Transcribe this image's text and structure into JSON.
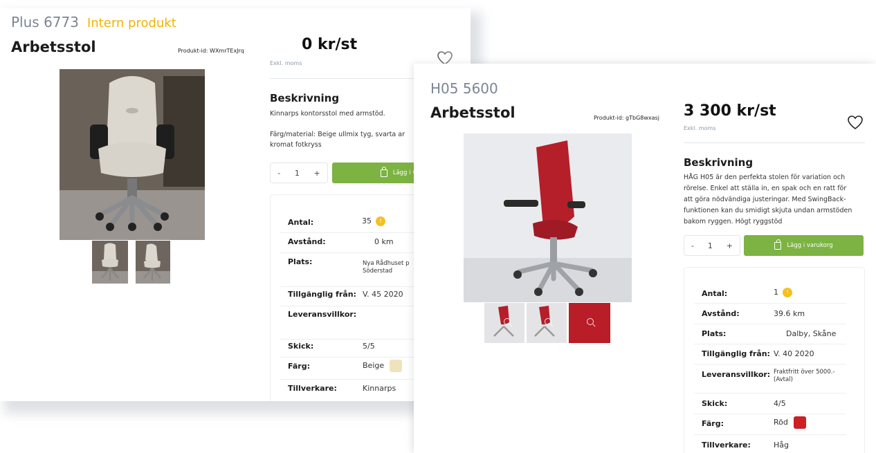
{
  "left_card": {
    "code": "Plus 6773",
    "tag": "Intern produkt",
    "title": "Arbetsstol",
    "product_id": "Produkt-id: WXmrTExJrq",
    "price": "0 kr/st",
    "exkl": "Exkl. moms",
    "description_heading": "Beskrivning",
    "description_line1": "Kinnarps kontorsstol med armstöd.",
    "description_line2": "Färg/material: Beige ullmix tyg, svarta ar",
    "description_line3": "kromat fotkryss",
    "qty_minus": "-",
    "qty_value": "1",
    "qty_plus": "+",
    "cart_label": "Lägg i varuk",
    "specs": {
      "antal_label": "Antal:",
      "antal_value": "35",
      "avstand_label": "Avstånd:",
      "avstand_value": "0 km",
      "plats_label": "Plats:",
      "plats_value_1": "Nya Rådhuset p",
      "plats_value_2": "Söderstad",
      "tillganglig_label": "Tillgänglig från:",
      "tillganglig_value": "V. 45 2020",
      "leverans_label": "Leveransvillkor:",
      "skick_label": "Skick:",
      "skick_value": "5/5",
      "farg_label": "Färg:",
      "farg_value": "Beige",
      "farg_color": "#efe3bd",
      "tillverkare_label": "Tillverkare:",
      "tillverkare_value": "Kinnarps"
    }
  },
  "right_card": {
    "code": "H05 5600",
    "title": "Arbetsstol",
    "product_id": "Produkt-id: gTbG8wxasj",
    "price": "3 300 kr/st",
    "exkl": "Exkl. moms",
    "description_heading": "Beskrivning",
    "description_lines": [
      "HÅG H05 är den perfekta stolen för variation och",
      "rörelse. Enkel att ställa in, en spak och en ratt för",
      "att göra nödvändiga justeringar. Med SwingBack-",
      "funktionen kan du smidigt skjuta undan armstöden",
      "bakom ryggen. Högt ryggstöd"
    ],
    "qty_minus": "-",
    "qty_value": "1",
    "qty_plus": "+",
    "cart_label": "Lägg i varukorg",
    "specs": {
      "antal_label": "Antal:",
      "antal_value": "1",
      "avstand_label": "Avstånd:",
      "avstand_value": "39.6 km",
      "plats_label": "Plats:",
      "plats_value": "Dalby, Skåne",
      "tillganglig_label": "Tillgänglig från:",
      "tillganglig_value": "V. 40 2020",
      "leverans_label": "Leveransvillkor:",
      "leverans_value_1": "Fraktfritt över 5000.-",
      "leverans_value_2": "(Avtal)",
      "skick_label": "Skick:",
      "skick_value": "4/5",
      "farg_label": "Färg:",
      "farg_value": "Röd",
      "farg_color": "#cc1f26",
      "tillverkare_label": "Tillverkare:",
      "tillverkare_value": "Håg"
    }
  },
  "colors": {
    "accent_green": "#7cb342",
    "intern_yellow": "#f0b400",
    "badge_yellow": "#f5c020"
  },
  "icons": [
    "heart-icon",
    "bag-icon",
    "search-icon",
    "alert-dot-icon"
  ]
}
